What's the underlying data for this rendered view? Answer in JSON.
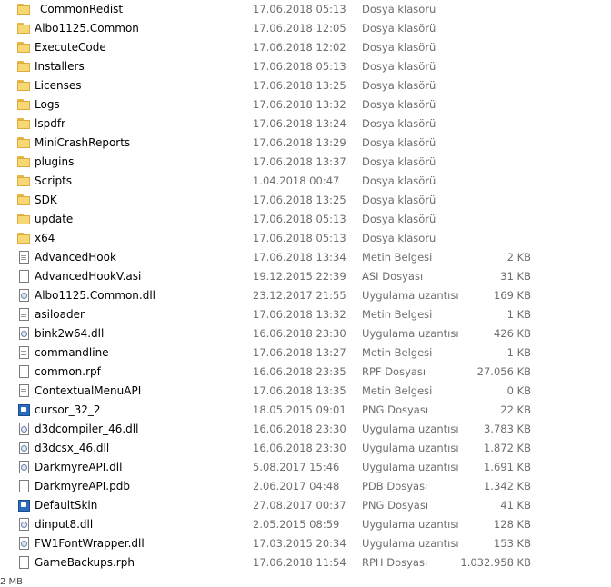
{
  "files": [
    {
      "name": "_CommonRedist",
      "date": "17.06.2018 05:13",
      "type": "Dosya klasörü",
      "size": "",
      "icon": "folder-icon"
    },
    {
      "name": "Albo1125.Common",
      "date": "17.06.2018 12:05",
      "type": "Dosya klasörü",
      "size": "",
      "icon": "folder-icon"
    },
    {
      "name": "ExecuteCode",
      "date": "17.06.2018 12:02",
      "type": "Dosya klasörü",
      "size": "",
      "icon": "folder-icon"
    },
    {
      "name": "Installers",
      "date": "17.06.2018 05:13",
      "type": "Dosya klasörü",
      "size": "",
      "icon": "folder-icon"
    },
    {
      "name": "Licenses",
      "date": "17.06.2018 13:25",
      "type": "Dosya klasörü",
      "size": "",
      "icon": "folder-icon"
    },
    {
      "name": "Logs",
      "date": "17.06.2018 13:32",
      "type": "Dosya klasörü",
      "size": "",
      "icon": "folder-icon"
    },
    {
      "name": "lspdfr",
      "date": "17.06.2018 13:24",
      "type": "Dosya klasörü",
      "size": "",
      "icon": "folder-icon"
    },
    {
      "name": "MiniCrashReports",
      "date": "17.06.2018 13:29",
      "type": "Dosya klasörü",
      "size": "",
      "icon": "folder-icon"
    },
    {
      "name": "plugins",
      "date": "17.06.2018 13:37",
      "type": "Dosya klasörü",
      "size": "",
      "icon": "folder-icon"
    },
    {
      "name": "Scripts",
      "date": "1.04.2018 00:47",
      "type": "Dosya klasörü",
      "size": "",
      "icon": "folder-icon"
    },
    {
      "name": "SDK",
      "date": "17.06.2018 13:25",
      "type": "Dosya klasörü",
      "size": "",
      "icon": "folder-icon"
    },
    {
      "name": "update",
      "date": "17.06.2018 05:13",
      "type": "Dosya klasörü",
      "size": "",
      "icon": "folder-icon"
    },
    {
      "name": "x64",
      "date": "17.06.2018 05:13",
      "type": "Dosya klasörü",
      "size": "",
      "icon": "folder-icon"
    },
    {
      "name": "AdvancedHook",
      "date": "17.06.2018 13:34",
      "type": "Metin Belgesi",
      "size": "2 KB",
      "icon": "text-document-icon"
    },
    {
      "name": "AdvancedHookV.asi",
      "date": "19.12.2015 22:39",
      "type": "ASI Dosyası",
      "size": "31 KB",
      "icon": "blank-document-icon"
    },
    {
      "name": "Albo1125.Common.dll",
      "date": "23.12.2017 21:55",
      "type": "Uygulama uzantısı",
      "size": "169 KB",
      "icon": "dll-file-icon"
    },
    {
      "name": "asiloader",
      "date": "17.06.2018 13:32",
      "type": "Metin Belgesi",
      "size": "1 KB",
      "icon": "text-document-icon"
    },
    {
      "name": "bink2w64.dll",
      "date": "16.06.2018 23:30",
      "type": "Uygulama uzantısı",
      "size": "426 KB",
      "icon": "dll-file-icon"
    },
    {
      "name": "commandline",
      "date": "17.06.2018 13:27",
      "type": "Metin Belgesi",
      "size": "1 KB",
      "icon": "text-document-icon"
    },
    {
      "name": "common.rpf",
      "date": "16.06.2018 23:35",
      "type": "RPF Dosyası",
      "size": "27.056 KB",
      "icon": "blank-document-icon"
    },
    {
      "name": "ContextualMenuAPI",
      "date": "17.06.2018 13:35",
      "type": "Metin Belgesi",
      "size": "0 KB",
      "icon": "text-document-icon"
    },
    {
      "name": "cursor_32_2",
      "date": "18.05.2015 09:01",
      "type": "PNG Dosyası",
      "size": "22 KB",
      "icon": "image-file-icon"
    },
    {
      "name": "d3dcompiler_46.dll",
      "date": "16.06.2018 23:30",
      "type": "Uygulama uzantısı",
      "size": "3.783 KB",
      "icon": "dll-file-icon"
    },
    {
      "name": "d3dcsx_46.dll",
      "date": "16.06.2018 23:30",
      "type": "Uygulama uzantısı",
      "size": "1.872 KB",
      "icon": "dll-file-icon"
    },
    {
      "name": "DarkmyreAPI.dll",
      "date": "5.08.2017 15:46",
      "type": "Uygulama uzantısı",
      "size": "1.691 KB",
      "icon": "dll-file-icon"
    },
    {
      "name": "DarkmyreAPI.pdb",
      "date": "2.06.2017 04:48",
      "type": "PDB Dosyası",
      "size": "1.342 KB",
      "icon": "blank-document-icon"
    },
    {
      "name": "DefaultSkin",
      "date": "27.08.2017 00:37",
      "type": "PNG Dosyası",
      "size": "41 KB",
      "icon": "image-file-icon"
    },
    {
      "name": "dinput8.dll",
      "date": "2.05.2015 08:59",
      "type": "Uygulama uzantısı",
      "size": "128 KB",
      "icon": "dll-file-icon"
    },
    {
      "name": "FW1FontWrapper.dll",
      "date": "17.03.2015 20:34",
      "type": "Uygulama uzantısı",
      "size": "153 KB",
      "icon": "dll-file-icon"
    },
    {
      "name": "GameBackups.rph",
      "date": "17.06.2018 11:54",
      "type": "RPH Dosyası",
      "size": "1.032.958 KB",
      "icon": "blank-document-icon"
    }
  ],
  "status_bar": {
    "fragment": "2 MB"
  }
}
